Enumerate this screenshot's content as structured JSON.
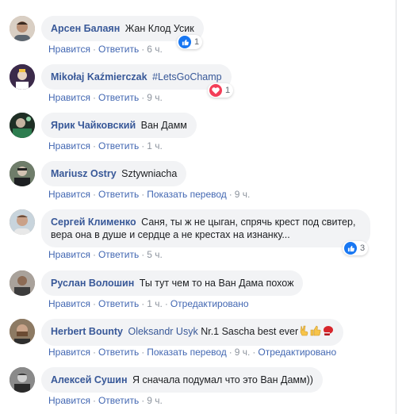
{
  "actions": {
    "like": "Нравится",
    "reply": "Ответить",
    "translate": "Показать перевод",
    "edited": "Отредактировано",
    "sep": "·"
  },
  "comments": [
    {
      "author": "Арсен Балаян",
      "text": "Жан Клод Усик",
      "time": "6 ч.",
      "reaction": "like",
      "reaction_count": "1",
      "avatar_color": "#b99478"
    },
    {
      "author": "Mikołaj Kaźmierczak",
      "tag": "#LetsGoChamp",
      "time": "9 ч.",
      "reaction": "love",
      "reaction_count": "1",
      "avatar_color": "#5a3b6e"
    },
    {
      "author": "Ярик Чайковский",
      "text": "Ван Дамм",
      "time": "1 ч.",
      "avatar_color": "#2e4a3a"
    },
    {
      "author": "Mariusz Ostry",
      "text": "Sztywniacha",
      "time": "9 ч.",
      "avatar_color": "#3f4a3d"
    },
    {
      "author": "Сергей Клименко",
      "text": "Саня, ты ж не цыган, спрячь крест под свитер, вера она в душе и сердце а не крестах на изнанку...",
      "time": "5 ч.",
      "reaction": "like",
      "reaction_count": "3",
      "avatar_color": "#a88e7a"
    },
    {
      "author": "Руслан Волошин",
      "text": "Ты тут чем то на Ван Дама похож",
      "time": "1 ч.",
      "avatar_color": "#6b5e56"
    },
    {
      "author": "Herbert Bounty",
      "tag": "Oleksandr Usyk",
      "text": "Nr.1 Sascha best ever",
      "time": "9 ч.",
      "avatar_color": "#7a6651"
    },
    {
      "author": "Алексей Сушин",
      "text": "Я сначала подумал что это Ван Дамм))",
      "time": "9 ч.",
      "avatar_color": "#4b4b4b"
    }
  ]
}
